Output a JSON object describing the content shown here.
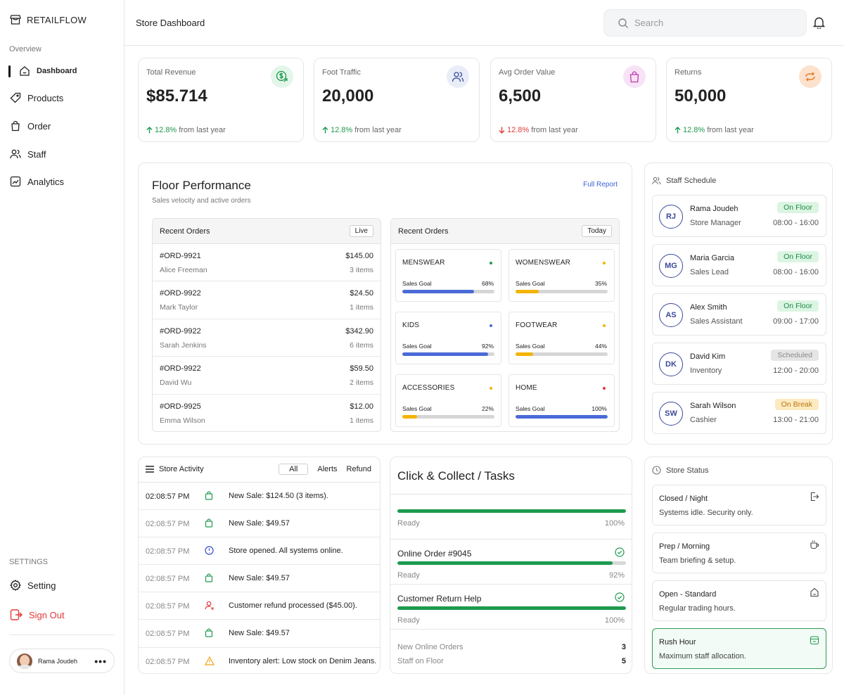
{
  "app": {
    "brand": "RETAILFLOW"
  },
  "sidebar": {
    "overview_label": "Overview",
    "items": [
      {
        "label": "Dashboard",
        "icon": "home-icon"
      },
      {
        "label": "Products",
        "icon": "tag-icon"
      },
      {
        "label": "Order",
        "icon": "shopping-bag-icon"
      },
      {
        "label": "Staff",
        "icon": "users-icon"
      },
      {
        "label": "Analytics",
        "icon": "chart-icon"
      }
    ],
    "settings_label": "SETTINGS",
    "setting": "Setting",
    "signout": "Sign Out",
    "user_name": "Rama Joudeh",
    "more": "•••"
  },
  "header": {
    "title": "Store Dashboard",
    "search_placeholder": "Search"
  },
  "stats": [
    {
      "label": "Total Revenue",
      "value": "$85.714",
      "pct": "12.8%",
      "dir": "up",
      "suffix": "from last year",
      "color": "#e3f6e9"
    },
    {
      "label": "Foot Traffic",
      "value": "20,000",
      "pct": "12.8%",
      "dir": "up",
      "suffix": "from last year",
      "color": "#e8edf8"
    },
    {
      "label": "Avg Order Value",
      "value": "6,500",
      "pct": "12.8%",
      "dir": "down",
      "suffix": "from last year",
      "color": "#f7e3f6"
    },
    {
      "label": "Returns",
      "value": "50,000",
      "pct": "12.8%",
      "dir": "up",
      "suffix": "from last year",
      "color": "#fde1cc"
    }
  ],
  "floor": {
    "title": "Floor Performance",
    "subtitle": "Sales velocity and active orders",
    "link": "Full Report",
    "orders_title": "Recent Orders",
    "orders_tag": "Live",
    "orders": [
      {
        "id": "#ORD-9921",
        "name": "Alice Freeman",
        "amount": "$145.00",
        "items": "3 items"
      },
      {
        "id": "#ORD-9922",
        "name": "Mark Taylor",
        "amount": "$24.50",
        "items": "1 items"
      },
      {
        "id": "#ORD-9922",
        "name": "Sarah Jenkins",
        "amount": "$342.90",
        "items": "6 items"
      },
      {
        "id": "#ORD-9922",
        "name": "David Wu",
        "amount": "$59.50",
        "items": "2 items"
      },
      {
        "id": "#ORD-9925",
        "name": "Emma Wilson",
        "amount": "$12.00",
        "items": "1 items"
      }
    ],
    "cats_title": "Recent Orders",
    "cats_tag": "Today",
    "goal_label": "Sales Goal",
    "categories": [
      {
        "name": "MENSWEAR",
        "pct": "68%",
        "value": 0.78,
        "bar": "#4a6ad8",
        "dot": "#1d9a4e"
      },
      {
        "name": "WOMENSWEAR",
        "pct": "35%",
        "value": 0.25,
        "bar": "#f4b400",
        "dot": "#f4b400"
      },
      {
        "name": "KIDS",
        "pct": "92%",
        "value": 0.93,
        "bar": "#4a6ad8",
        "dot": "#4a6ad8"
      },
      {
        "name": "FOOTWEAR",
        "pct": "44%",
        "value": 0.19,
        "bar": "#f4b400",
        "dot": "#f4b400"
      },
      {
        "name": "ACCESSORIES",
        "pct": "22%",
        "value": 0.16,
        "bar": "#f4b400",
        "dot": "#f4b400"
      },
      {
        "name": "HOME",
        "pct": "100%",
        "value": 1.0,
        "bar": "#4a6ad8",
        "dot": "#e03a3a"
      }
    ]
  },
  "schedule": {
    "title": "Staff Schedule",
    "staff": [
      {
        "initials": "RJ",
        "name": "Rama Joudeh",
        "role": "Store Manager",
        "status": "On Floor",
        "kind": "floor",
        "time": "08:00 - 16:00"
      },
      {
        "initials": "MG",
        "name": "Maria Garcia",
        "role": "Sales Lead",
        "status": "On Floor",
        "kind": "floor",
        "time": "08:00 - 16:00"
      },
      {
        "initials": "AS",
        "name": "Alex Smith",
        "role": "Sales Assistant",
        "status": "On Floor",
        "kind": "floor",
        "time": "09:00 - 17:00"
      },
      {
        "initials": "DK",
        "name": "David Kim",
        "role": "Inventory",
        "status": "Scheduled",
        "kind": "sched",
        "time": "12:00 - 20:00"
      },
      {
        "initials": "SW",
        "name": "Sarah Wilson",
        "role": "Cashier",
        "status": "On Break",
        "kind": "break",
        "time": "13:00 - 21:00"
      }
    ]
  },
  "activity": {
    "title": "Store Activity",
    "tabs": [
      "All",
      "Alerts",
      "Refund"
    ],
    "rows": [
      {
        "time": "02:08:57 PM",
        "icon": "bag",
        "msg": "New Sale: $124.50 (3 items)."
      },
      {
        "time": "02:08:57 PM",
        "icon": "bag",
        "msg": "New Sale: $49.57"
      },
      {
        "time": "02:08:57 PM",
        "icon": "info",
        "msg": "Store opened. All systems online."
      },
      {
        "time": "02:08:57 PM",
        "icon": "bag",
        "msg": "New Sale: $49.57"
      },
      {
        "time": "02:08:57 PM",
        "icon": "refund",
        "msg": "Customer refund processed ($45.00)."
      },
      {
        "time": "02:08:57 PM",
        "icon": "bag",
        "msg": "New Sale: $49.57"
      },
      {
        "time": "02:08:57 PM",
        "icon": "warn",
        "msg": "Inventory alert: Low stock on Denim Jeans."
      }
    ]
  },
  "tasks": {
    "title": "Click & Collect / Tasks",
    "items": [
      {
        "name": "",
        "state": "Ready",
        "pct": "100%",
        "value": 1.0
      },
      {
        "name": "Online Order #9045",
        "state": "Ready",
        "pct": "92%",
        "value": 0.94
      },
      {
        "name": "Customer Return Help",
        "state": "Ready",
        "pct": "100%",
        "value": 1.0
      }
    ],
    "stats": [
      {
        "label": "New Online Orders",
        "value": "3"
      },
      {
        "label": "Staff on Floor",
        "value": "5"
      }
    ]
  },
  "status": {
    "title": "Store Status",
    "modes": [
      {
        "name": "Closed / Night",
        "desc": "Systems idle. Security only.",
        "icon": "exit-icon"
      },
      {
        "name": "Prep / Morning",
        "desc": "Team briefing & setup.",
        "icon": "coffee-icon"
      },
      {
        "name": "Open - Standard",
        "desc": "Regular trading hours.",
        "icon": "store-icon"
      },
      {
        "name": "Rush Hour",
        "desc": "Maximum staff allocation.",
        "icon": "store-active-icon"
      }
    ]
  }
}
